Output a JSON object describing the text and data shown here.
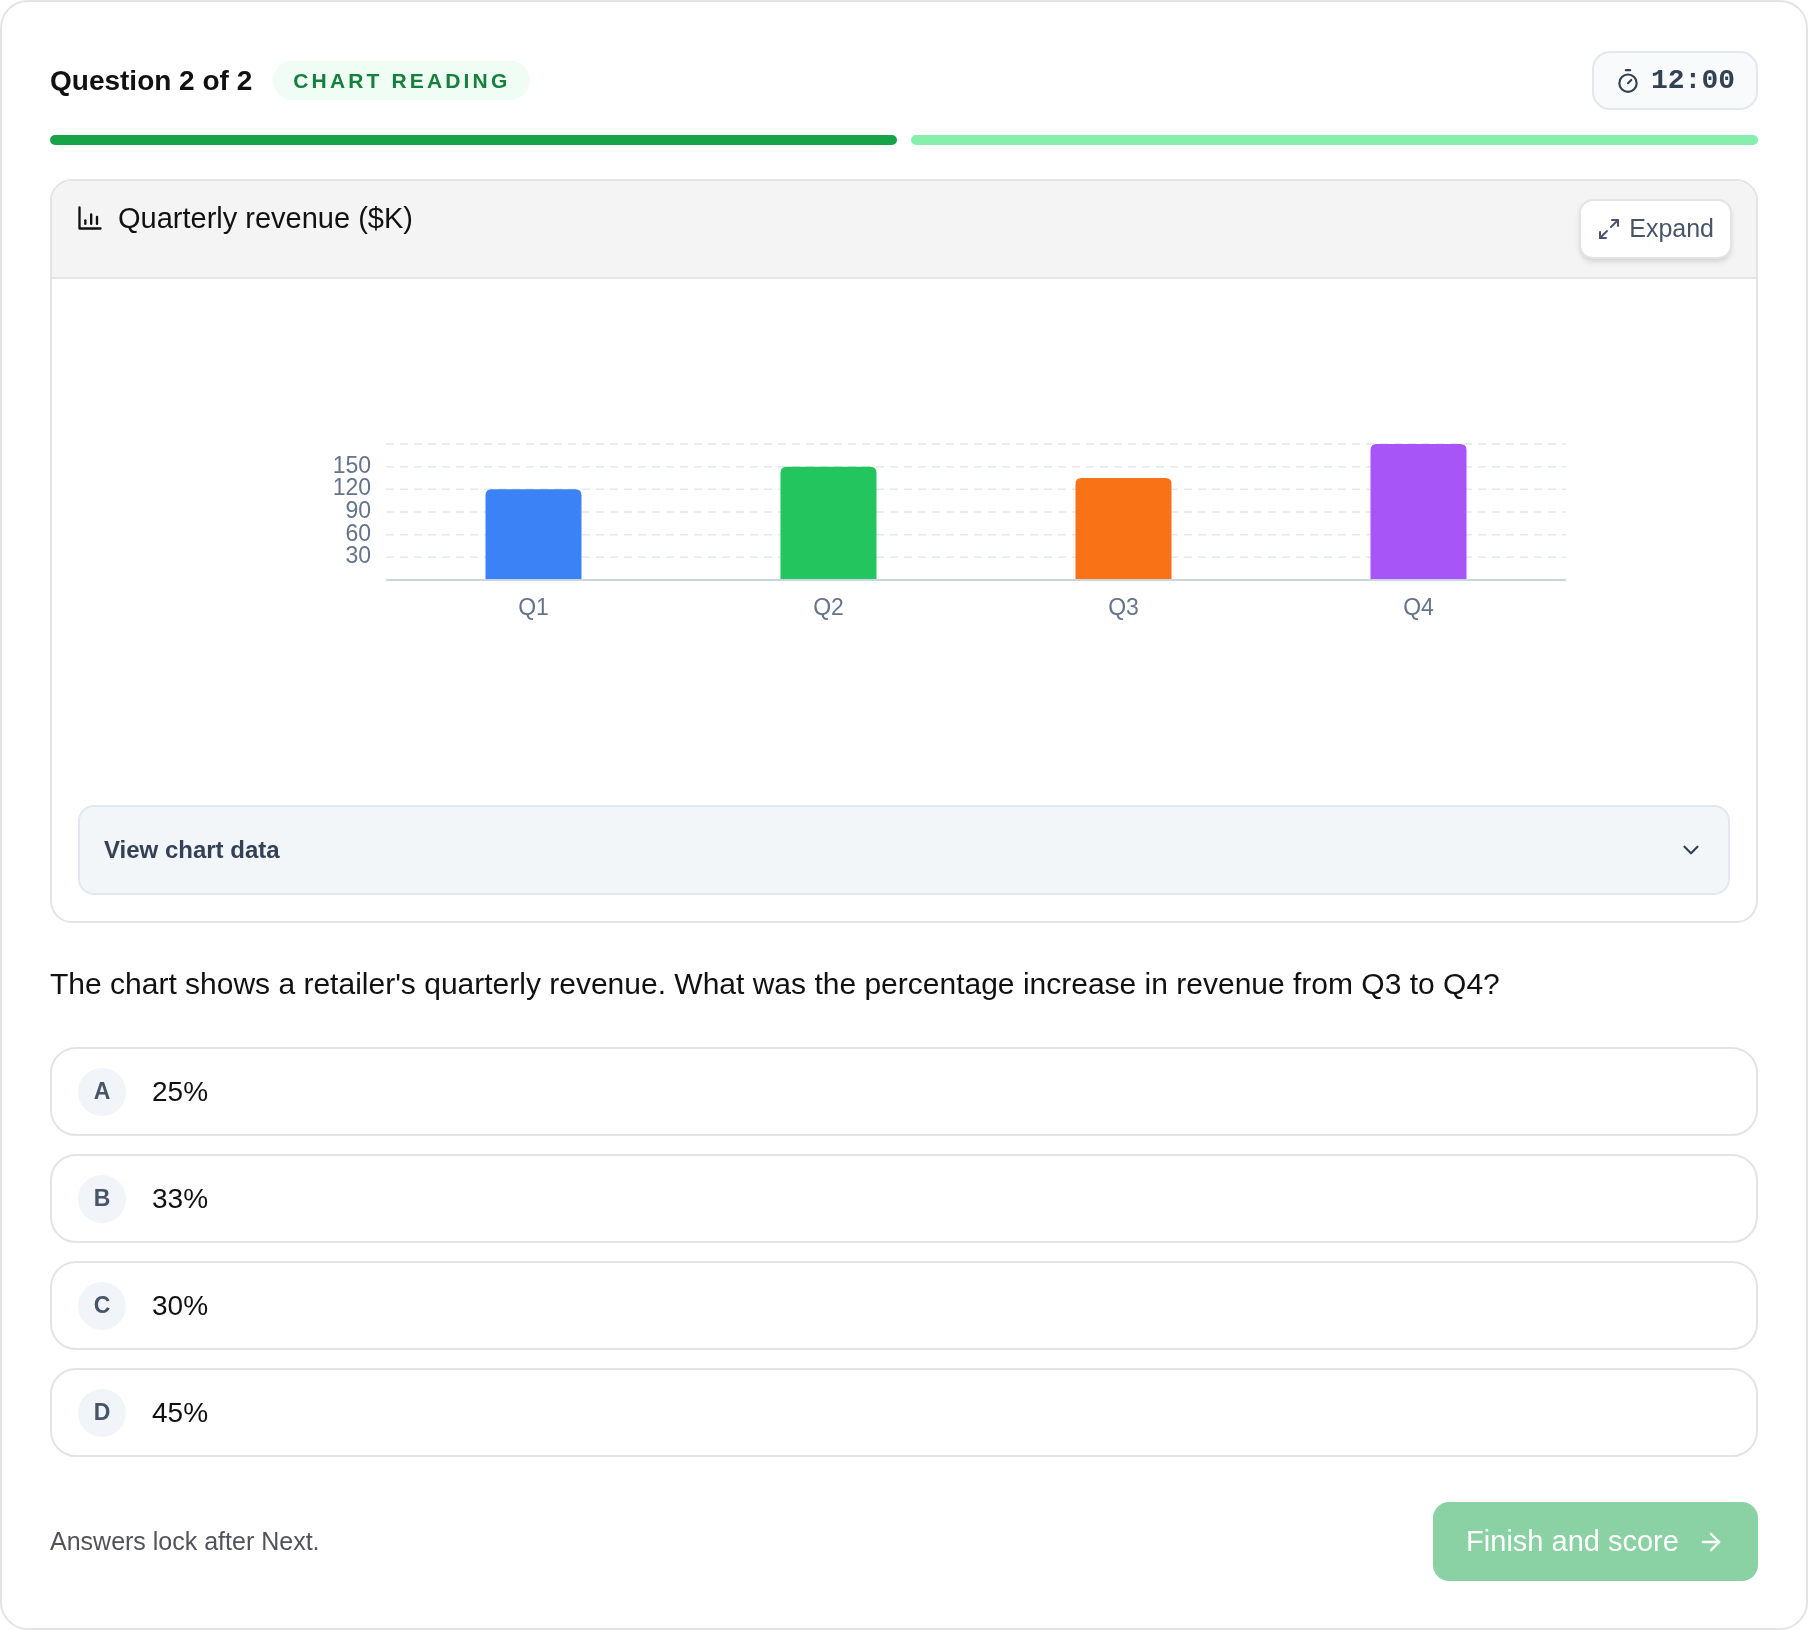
{
  "header": {
    "question_label": "Question 2 of 2",
    "badge": "CHART READING",
    "timer": "12:00"
  },
  "progress": [
    {
      "completed": true
    },
    {
      "completed": false
    }
  ],
  "chart_card": {
    "expand_button": "Expand",
    "chart_data": {
      "type": "bar",
      "title": "Quarterly revenue ($K)",
      "categories": [
        "Q1",
        "Q2",
        "Q3",
        "Q4"
      ],
      "series": [
        {
          "values": [
            120,
            150,
            135,
            180
          ]
        }
      ],
      "colors": [
        "#3b82f6",
        "#22c55e",
        "#f97316",
        "#a855f7"
      ],
      "ylim": [
        0,
        180
      ],
      "yticks": [
        30,
        60,
        90,
        120,
        150
      ],
      "grid": true
    },
    "data_toggle": {
      "label": "View chart data",
      "expanded": false
    }
  },
  "question": "The chart shows a retailer's quarterly revenue. What was the percentage increase in revenue from Q3 to Q4?",
  "options": [
    {
      "letter": "A",
      "text": "25%",
      "selected": false
    },
    {
      "letter": "B",
      "text": "33%",
      "selected": false
    },
    {
      "letter": "C",
      "text": "30%",
      "selected": false
    },
    {
      "letter": "D",
      "text": "45%",
      "selected": false
    }
  ],
  "footer": {
    "note": "Answers lock after Next.",
    "button": {
      "label": "Finish and score",
      "disabled": true
    }
  }
}
